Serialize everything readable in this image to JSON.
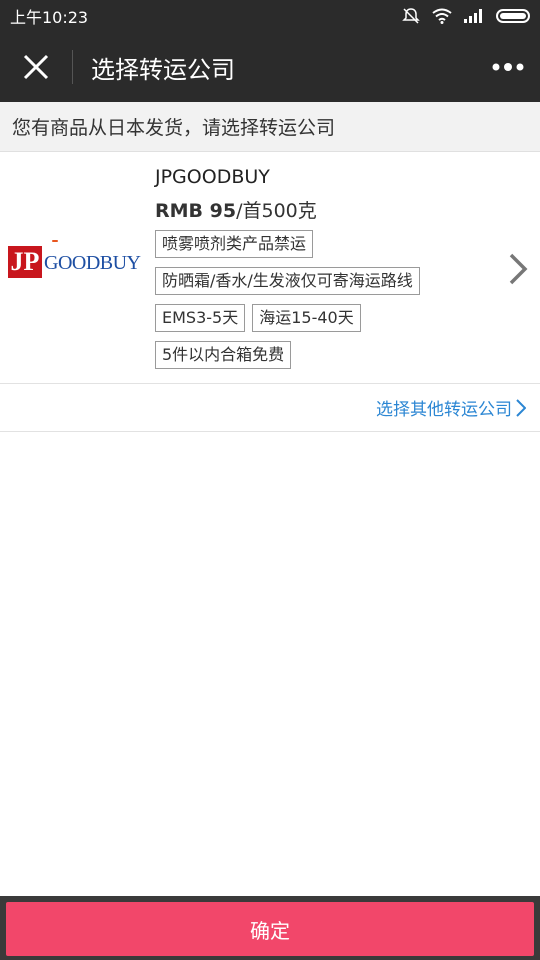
{
  "status_bar": {
    "time": "上午10:23"
  },
  "nav": {
    "title": "选择转运公司"
  },
  "notice": {
    "text": "您有商品从日本发货，请选择转运公司"
  },
  "company": {
    "logo_mark": "JP",
    "logo_label": "GOODBUY",
    "name": "JPGOODBUY",
    "price_amount": "RMB 95",
    "price_unit": "/首500克",
    "tags": [
      "喷雾喷剂类产品禁运",
      "防晒霜/香水/生发液仅可寄海运路线",
      "EMS3-5天",
      "海运15-40天",
      "5件以内合箱免费"
    ]
  },
  "other_link": {
    "label": "选择其他转运公司"
  },
  "confirm": {
    "label": "确定"
  },
  "colors": {
    "nav_bg": "#2b2b2b",
    "link": "#2b86d3",
    "confirm_bg": "#f2476a",
    "logo_red": "#c8161d",
    "logo_blue": "#1e4fa3"
  }
}
